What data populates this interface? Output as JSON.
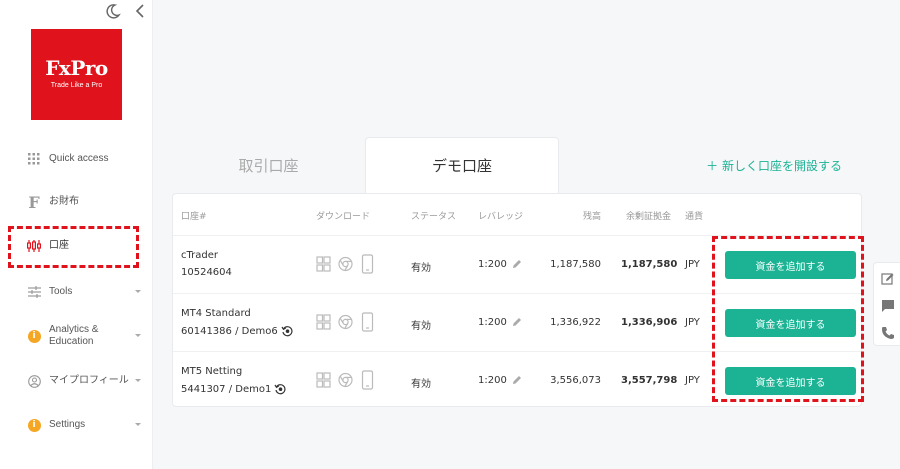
{
  "sidebar": {
    "logo": {
      "word": "FxPro",
      "tagline": "Trade Like a Pro"
    },
    "items": [
      {
        "label": "Quick access",
        "icon": "grid-icon"
      },
      {
        "label": "お財布",
        "icon": "wallet-f-icon"
      },
      {
        "label": "口座",
        "icon": "candlestick-icon",
        "active": true
      },
      {
        "label": "Tools",
        "icon": "sliders-icon"
      },
      {
        "label": "Analytics &\nEducation",
        "icon": "info-icon"
      },
      {
        "label": "マイプロフィール",
        "icon": "user-circle-icon"
      },
      {
        "label": "Settings",
        "icon": "info-icon"
      }
    ]
  },
  "tabs": {
    "trade": "取引口座",
    "demo": "デモ口座"
  },
  "new_account": "＋ 新しく口座を開設する",
  "table": {
    "headers": {
      "account": "口座#",
      "download": "ダウンロード",
      "status": "ステータス",
      "leverage": "レバレッジ",
      "balance": "残高",
      "free_margin": "余剰証拠金",
      "currency": "通貨"
    },
    "rows": [
      {
        "name": "cTrader",
        "number": "10524604",
        "demo_icon": false,
        "status": "有効",
        "leverage": "1:200",
        "balance": "1,187,580",
        "free_margin": "1,187,580",
        "currency": "JPY",
        "button": "資金を追加する"
      },
      {
        "name": "MT4 Standard",
        "number": "60141386 / Demo6",
        "demo_icon": true,
        "status": "有効",
        "leverage": "1:200",
        "balance": "1,336,922",
        "free_margin": "1,336,906",
        "currency": "JPY",
        "button": "資金を追加する"
      },
      {
        "name": "MT5 Netting",
        "number": "5441307 / Demo1",
        "demo_icon": true,
        "status": "有効",
        "leverage": "1:200",
        "balance": "3,556,073",
        "free_margin": "3,557,798",
        "currency": "JPY",
        "button": "資金を追加する"
      }
    ]
  },
  "colors": {
    "accent": "#1bb394",
    "brand": "#e0131c",
    "highlight": "#e0131c"
  }
}
